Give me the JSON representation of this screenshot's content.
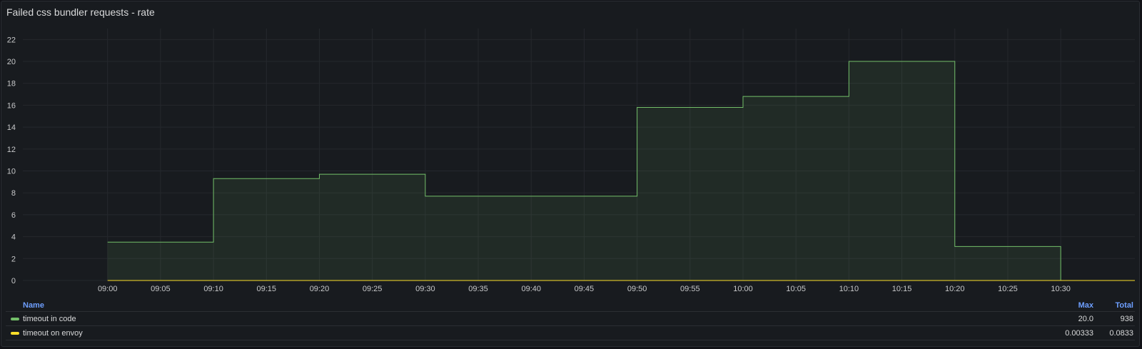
{
  "panel": {
    "title": "Failed css bundler requests - rate"
  },
  "legend": {
    "name_header": "Name",
    "max_header": "Max",
    "total_header": "Total",
    "rows": [
      {
        "name": "timeout in code",
        "max": "20.0",
        "total": "938",
        "color": "#73bf69"
      },
      {
        "name": "timeout on envoy",
        "max": "0.00333",
        "total": "0.0833",
        "color": "#fade2a"
      }
    ]
  },
  "chart_data": {
    "type": "area",
    "x_ticks": [
      "09:00",
      "09:05",
      "09:10",
      "09:15",
      "09:20",
      "09:25",
      "09:30",
      "09:35",
      "09:40",
      "09:45",
      "09:50",
      "09:55",
      "10:00",
      "10:05",
      "10:10",
      "10:15",
      "10:20",
      "10:25",
      "10:30"
    ],
    "y_ticks": [
      "0",
      "2",
      "4",
      "6",
      "8",
      "10",
      "12",
      "14",
      "16",
      "18",
      "20",
      "22"
    ],
    "ylim": [
      0,
      23
    ],
    "xlim": [
      "08:52",
      "10:37"
    ],
    "grid": true,
    "step": true,
    "series": [
      {
        "name": "timeout in code",
        "color": "#73bf69",
        "x": [
          "09:00",
          "09:10",
          "09:20",
          "09:30",
          "09:50",
          "10:00",
          "10:10",
          "10:20",
          "10:30"
        ],
        "values": [
          3.5,
          9.3,
          9.7,
          7.7,
          15.8,
          16.8,
          20.0,
          3.1,
          0
        ]
      },
      {
        "name": "timeout on envoy",
        "color": "#fade2a",
        "x": [
          "09:00",
          "10:37"
        ],
        "values": [
          0,
          0
        ]
      }
    ]
  }
}
